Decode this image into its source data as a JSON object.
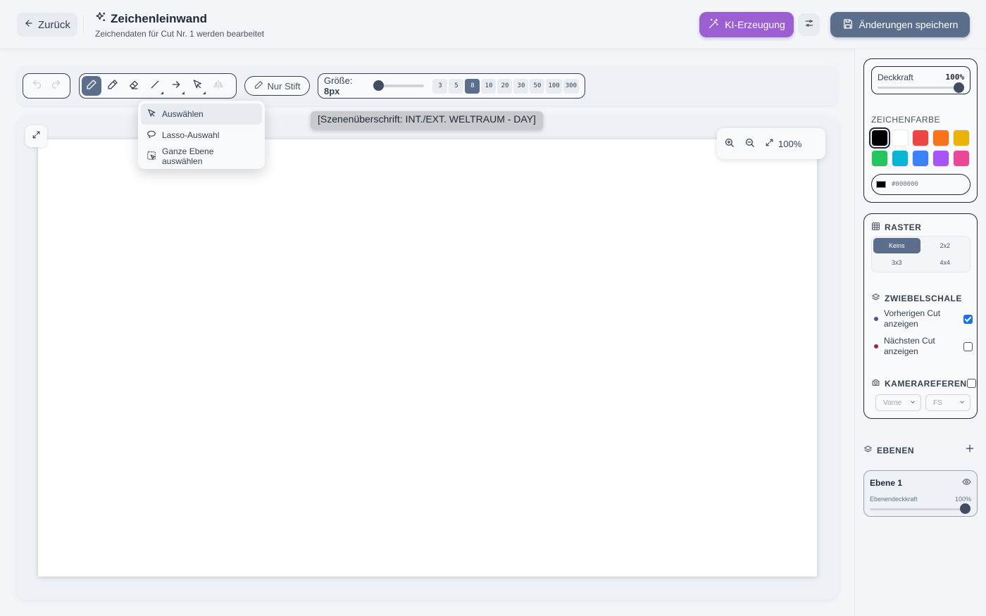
{
  "header": {
    "back_label": "Zurück",
    "title": "Zeichenleinwand",
    "subtitle": "Zeichendaten für Cut Nr. 1 werden bearbeitet",
    "ai_label": "KI-Erzeugung",
    "save_label": "Änderungen speichern"
  },
  "toolbar": {
    "pen_only_label": "Nur Stift",
    "size_prefix": "Größe:",
    "size_value": "8px",
    "size_presets": [
      "3",
      "5",
      "8",
      "10",
      "20",
      "30",
      "50",
      "100",
      "300"
    ],
    "active_preset": "8"
  },
  "select_menu": {
    "items": [
      "Auswählen",
      "Lasso-Auswahl",
      "Ganze Ebene auswählen"
    ]
  },
  "canvas": {
    "scene_heading": "[Szenenüberschrift: INT./EXT. WELTRAUM - DAY]",
    "zoom_level": "100%"
  },
  "panel": {
    "opacity_label": "Deckkraft",
    "opacity_value": "100%",
    "color_label": "ZEICHENFARBE",
    "colors": [
      "#000000",
      "#ffffff",
      "#ef4444",
      "#f97316",
      "#eab308",
      "#22c55e",
      "#06b6d4",
      "#3b82f6",
      "#a855f7",
      "#ec4899"
    ],
    "selected_color": "#000000",
    "hex_value": "#000000",
    "grid_label": "RASTER",
    "grid_options": [
      "Keins",
      "2x2",
      "3x3",
      "4x4"
    ],
    "grid_selected": "Keins",
    "onion_label": "ZWIEBELSCHALE",
    "onion_prev_label": "Vorherigen Cut anzeigen",
    "onion_next_label": "Nächsten Cut anzeigen",
    "onion_prev_checked": true,
    "onion_next_checked": false,
    "camera_label": "KAMERAREFERENZ",
    "camera_checked": false,
    "camera_angle": "Vorne",
    "camera_shot": "FS",
    "layers_label": "EBENEN",
    "layer_name": "Ebene 1",
    "layer_opacity_label": "Ebenendeckkraft",
    "layer_opacity_value": "100%"
  }
}
